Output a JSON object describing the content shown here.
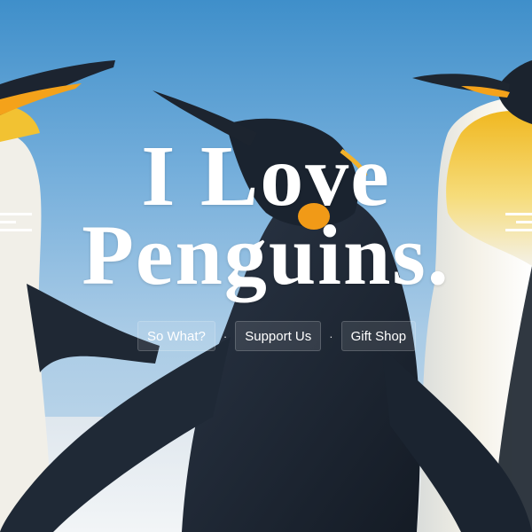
{
  "hero": {
    "title_line1": "I Love",
    "title_line2": "Penguins."
  },
  "nav": {
    "items": [
      {
        "label": "So What?"
      },
      {
        "label": "Support Us"
      },
      {
        "label": "Gift Shop"
      }
    ],
    "separator": "·"
  },
  "colors": {
    "sky_top": "#3f8fca",
    "sky_bottom": "#c9dcea",
    "penguin_body": "#1d2733",
    "penguin_belly": "#f3f1ea",
    "beak_accent": "#f4a21a",
    "chest_yellow": "#f2c232",
    "title_text": "#ffffff"
  }
}
